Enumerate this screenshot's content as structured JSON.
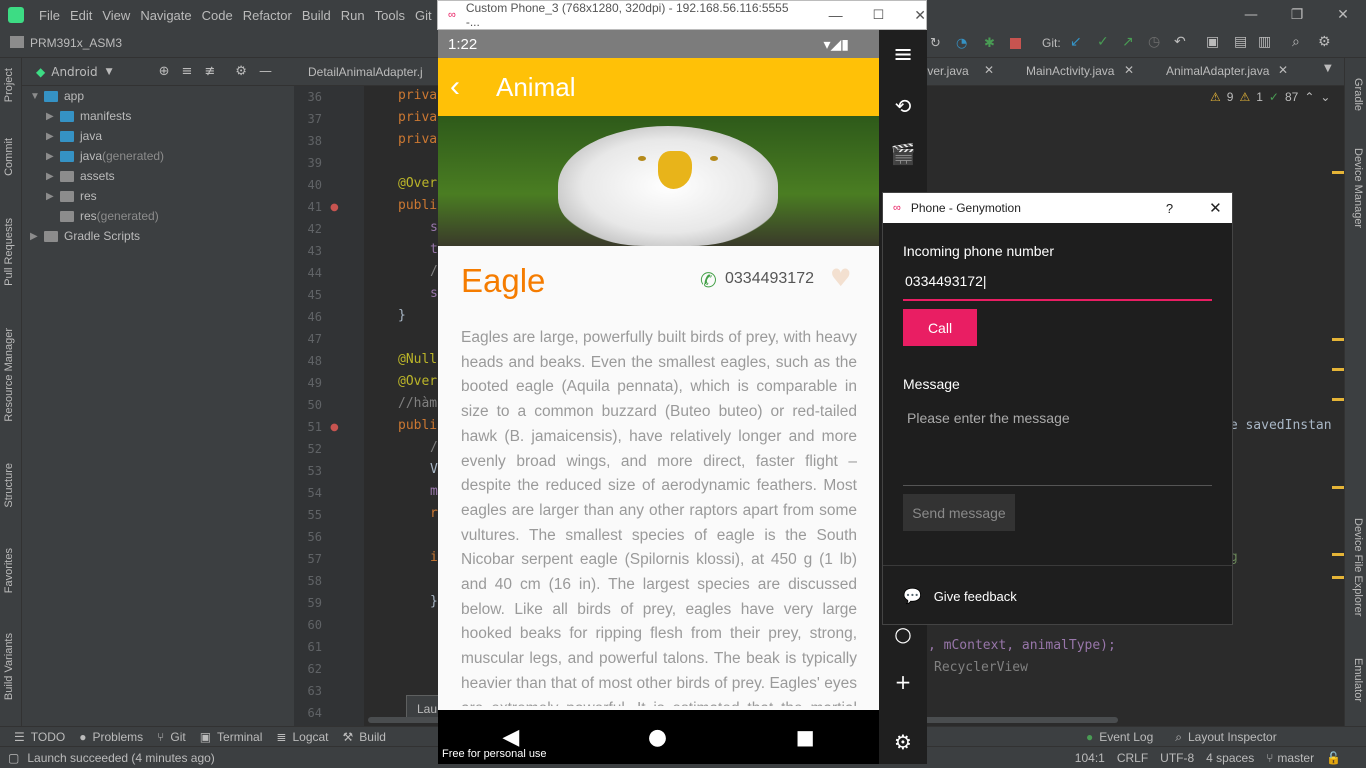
{
  "ide": {
    "menu": [
      "File",
      "Edit",
      "View",
      "Navigate",
      "Code",
      "Refactor",
      "Build",
      "Run",
      "Tools",
      "Git",
      "V"
    ],
    "project_name": "PRM391x_ASM3",
    "project_view": "Android",
    "tree": [
      {
        "label": "app",
        "level": 0
      },
      {
        "label": "manifests",
        "level": 1
      },
      {
        "label": "java",
        "level": 1
      },
      {
        "label": "java",
        "suffix": " (generated)",
        "level": 1
      },
      {
        "label": "assets",
        "level": 1
      },
      {
        "label": "res",
        "level": 1
      },
      {
        "label": "res",
        "suffix": " (generated)",
        "level": 1
      },
      {
        "label": "Gradle Scripts",
        "level": 0
      }
    ],
    "tabs": [
      "DetailAnimalAdapter.j",
      "eiver.java",
      "MainActivity.java",
      "AnimalAdapter.java"
    ],
    "line_numbers": [
      "36",
      "37",
      "38",
      "39",
      "40",
      "41",
      "42",
      "43",
      "44",
      "45",
      "46",
      "47",
      "48",
      "49",
      "50",
      "51",
      "52",
      "53",
      "54",
      "55",
      "56",
      "57",
      "58",
      "59",
      "60",
      "61",
      "62",
      "63",
      "64"
    ],
    "code_fragments": {
      "l36": "priva",
      "l37": "priva",
      "l38": "priva",
      "l40": "@Over",
      "l41": "publi",
      "l42": "s",
      "l43": "t",
      "l44": "/",
      "l45": "s",
      "l46": "}",
      "l48": "@Null",
      "l49": "@Over",
      "l50": "//hàm",
      "l51": "publi",
      "l52": "/",
      "l53": "V",
      "l54": "m",
      "l55": "r",
      "l57": "i",
      "l59": "}",
      "right1": "le savedInstan",
      "right2": "ng",
      "right3": ", mContext, animalType);",
      "right4": "RecyclerView"
    },
    "inspection": {
      "warnings": "9",
      "weak": "1",
      "typos": "87"
    },
    "left_tabs": [
      "Project",
      "Commit",
      "Pull Requests",
      "Resource Manager",
      "Structure",
      "Favorites",
      "Build Variants"
    ],
    "right_tabs": [
      "Gradle",
      "Device Manager",
      "Device File Explorer",
      "Emulator"
    ],
    "bottom_tools": [
      "TODO",
      "Problems",
      "Git",
      "Terminal",
      "Logcat",
      "Build"
    ],
    "bottom_right_tools": [
      "Event Log",
      "Layout Inspector"
    ],
    "toast": "Lau",
    "status": {
      "message": "Launch succeeded (4 minutes ago)",
      "position": "104:1",
      "line_sep": "CRLF",
      "encoding": "UTF-8",
      "indent": "4 spaces",
      "branch": "master"
    },
    "git_label": "Git:"
  },
  "emulator": {
    "window_title": "Custom Phone_3 (768x1280, 320dpi) - 192.168.56.116:5555 -...",
    "clock": "1:22",
    "app_title": "Animal",
    "animal_name": "Eagle",
    "phone_number": "0334493172",
    "description": "Eagles are large, powerfully built birds of prey, with heavy heads and beaks. Even the smallest eagles, such as the booted eagle (Aquila pennata), which is comparable in size to a common buzzard (Buteo buteo) or red-tailed hawk (B. jamaicensis), have relatively longer and more evenly broad wings, and more direct, faster flight – despite the reduced size of aerodynamic feathers. Most eagles are larger than any other raptors apart from some vultures. The smallest species of eagle is the South Nicobar serpent eagle (Spilornis klossi), at 450 g (1 lb) and 40 cm (16 in). The largest species are discussed below. Like all birds of prey, eagles have very large hooked beaks for ripping flesh from their prey, strong, muscular legs, and powerful talons. The beak is typically heavier than that of most other birds of prey. Eagles' eyes are extremely powerful. It is estimated that the martial eagle, whose",
    "watermark": "Free for personal use",
    "accent": "#ffc107",
    "name_color": "#f57c00"
  },
  "dialog": {
    "title": "Phone - Genymotion",
    "help": "?",
    "incoming_label": "Incoming phone number",
    "incoming_value": "0334493172",
    "call_button": "Call",
    "message_label": "Message",
    "message_placeholder": "Please enter the message",
    "send_button": "Send message",
    "feedback": "Give feedback",
    "accent": "#e91e63"
  }
}
